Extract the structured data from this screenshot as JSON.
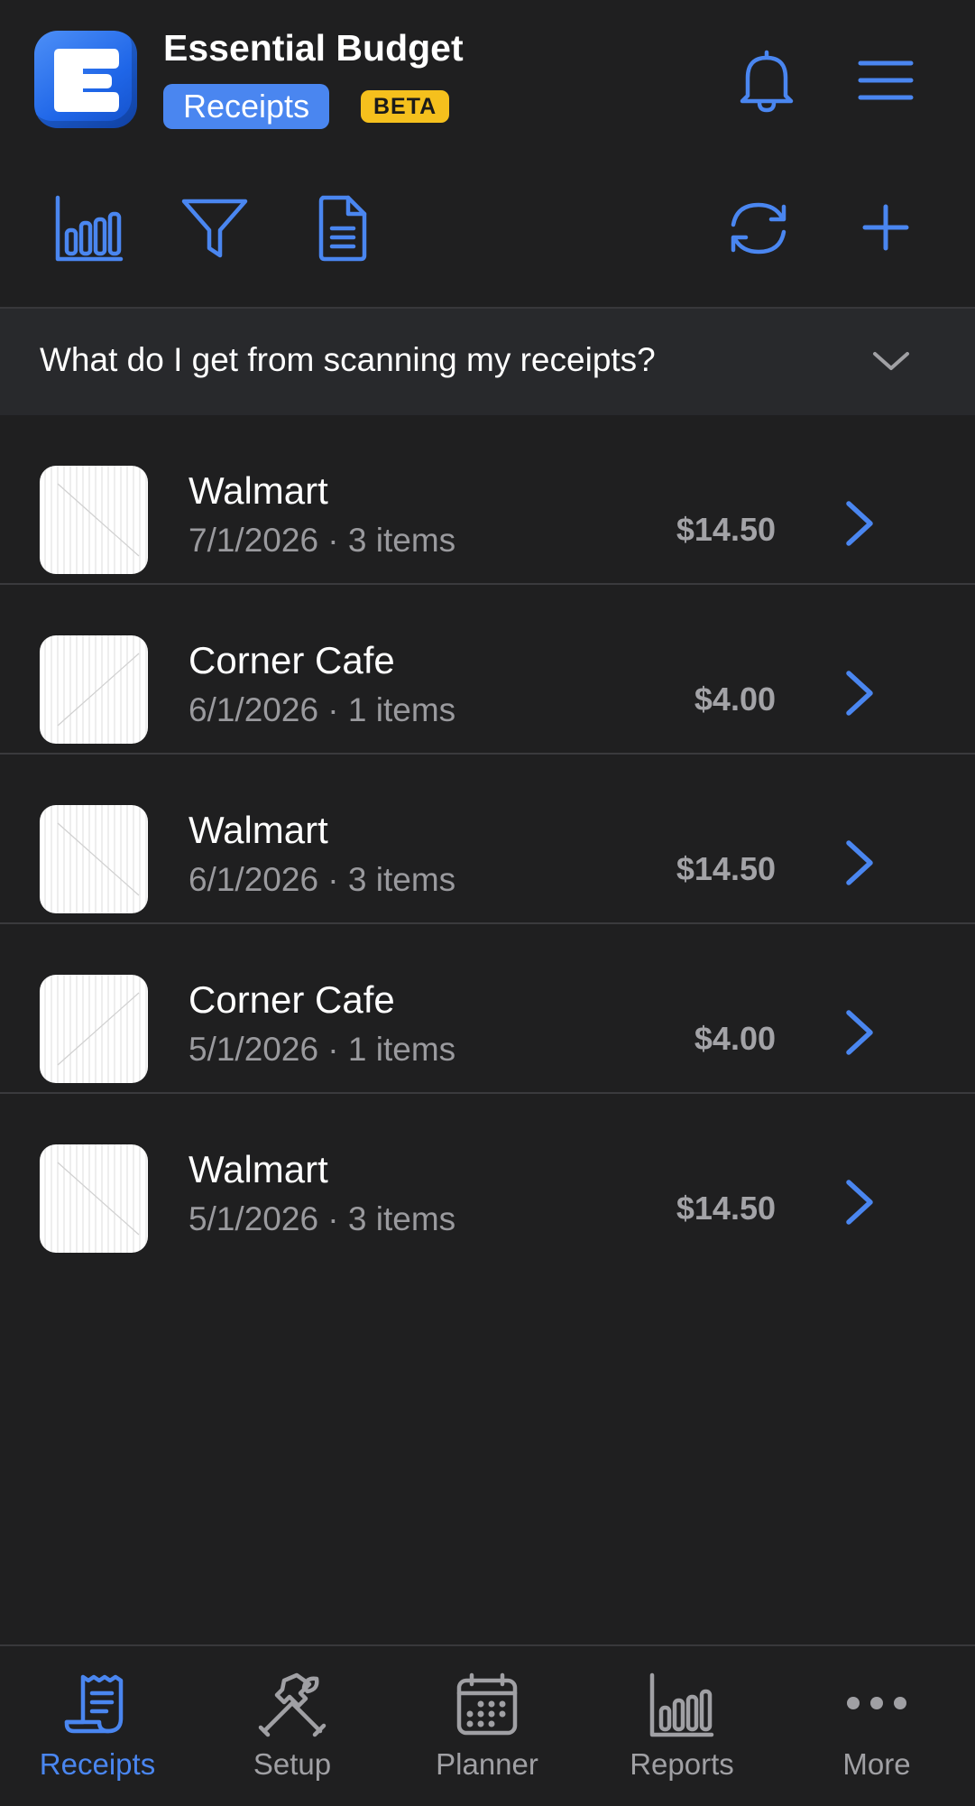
{
  "header": {
    "app_title": "Essential Budget",
    "section_label": "Receipts",
    "beta_label": "BETA",
    "icons": [
      "bell-icon",
      "hamburger-menu-icon"
    ]
  },
  "toolbar": {
    "icons": [
      "bar-chart-icon",
      "filter-icon",
      "document-icon",
      "sync-icon",
      "plus-icon"
    ]
  },
  "info_banner": {
    "text": "What do I get from scanning my receipts?",
    "icon": "chevron-down-icon"
  },
  "receipts": [
    {
      "merchant": "Walmart",
      "details": "7/1/2026 · 3 items",
      "amount": "$14.50"
    },
    {
      "merchant": "Corner Cafe",
      "details": "6/1/2026 · 1 items",
      "amount": "$4.00"
    },
    {
      "merchant": "Walmart",
      "details": "6/1/2026 · 3 items",
      "amount": "$14.50"
    },
    {
      "merchant": "Corner Cafe",
      "details": "5/1/2026 · 1 items",
      "amount": "$4.00"
    },
    {
      "merchant": "Walmart",
      "details": "5/1/2026 · 3 items",
      "amount": "$14.50"
    }
  ],
  "tabbar": {
    "tabs": [
      {
        "label": "Receipts",
        "icon": "receipt-icon",
        "active": true
      },
      {
        "label": "Setup",
        "icon": "tools-icon",
        "active": false
      },
      {
        "label": "Planner",
        "icon": "calendar-icon",
        "active": false
      },
      {
        "label": "Reports",
        "icon": "bar-chart-icon",
        "active": false
      },
      {
        "label": "More",
        "icon": "more-dots-icon",
        "active": false
      }
    ]
  },
  "colors": {
    "background": "#1f1f20",
    "accent": "#4a86f0",
    "beta": "#f5c01d",
    "banner": "#28292c",
    "secondary_text": "#9a9a9e"
  }
}
